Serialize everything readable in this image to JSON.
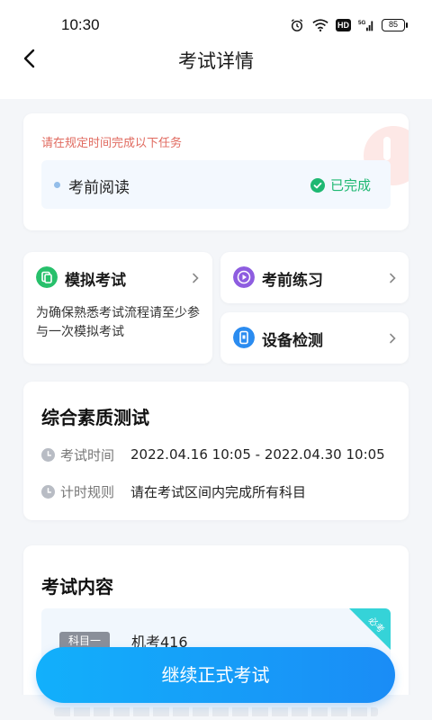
{
  "status_bar": {
    "time": "10:30",
    "signal_label": "5G",
    "hd_label": "HD",
    "battery": "85"
  },
  "nav": {
    "title": "考试详情"
  },
  "task_card": {
    "hint": "请在规定时间完成以下任务",
    "task_name": "考前阅读",
    "task_status": "已完成"
  },
  "features": {
    "mock_exam": {
      "title": "模拟考试",
      "description": "为确保熟悉考试流程请至少参与一次模拟考试",
      "icon": "mock-exam-icon",
      "color": "#27c06b"
    },
    "practice": {
      "title": "考前练习",
      "icon": "play-icon",
      "color": "#8e5de0"
    },
    "device_check": {
      "title": "设备检测",
      "icon": "phone-icon",
      "color": "#2b8cf0"
    }
  },
  "exam_info": {
    "title": "综合素质测试",
    "time_label": "考试时间",
    "time_value": "2022.04.16 10:05 - 2022.04.30 10:05",
    "rule_label": "计时规则",
    "rule_value": "请在考试区间内完成所有科目"
  },
  "exam_content": {
    "title": "考试内容",
    "subject_tag": "科目一",
    "subject_name": "机考416",
    "required_badge": "必考"
  },
  "cta": {
    "label": "继续正式考试"
  },
  "colors": {
    "accent": "#1a8cf6",
    "success": "#1eb872",
    "warning_text": "#e06a5f"
  }
}
